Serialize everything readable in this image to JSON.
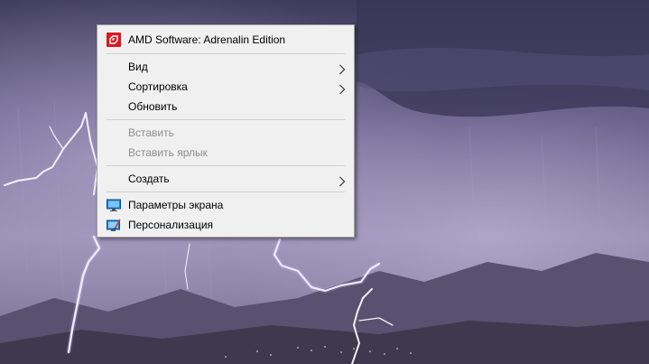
{
  "desktop": {
    "wallpaper": "purple sky with lightning over mountains",
    "colors": {
      "sky_top": "#4e4a6c",
      "sky_mid": "#7d7399",
      "sky_low": "#9a8fb2",
      "ground": "#4a4458"
    }
  },
  "context_menu": {
    "items": [
      {
        "label": "AMD Software: Adrenalin Edition",
        "icon": "amd-radeon-icon",
        "disabled": false,
        "submenu": false
      },
      {
        "type": "separator"
      },
      {
        "label": "Вид",
        "disabled": false,
        "submenu": true
      },
      {
        "label": "Сортировка",
        "disabled": false,
        "submenu": true
      },
      {
        "label": "Обновить",
        "disabled": false,
        "submenu": false
      },
      {
        "type": "separator"
      },
      {
        "label": "Вставить",
        "disabled": true,
        "submenu": false
      },
      {
        "label": "Вставить ярлык",
        "disabled": true,
        "submenu": false
      },
      {
        "type": "separator"
      },
      {
        "label": "Создать",
        "disabled": false,
        "submenu": true
      },
      {
        "type": "separator"
      },
      {
        "label": "Параметры экрана",
        "icon": "display-settings-icon",
        "disabled": false,
        "submenu": false
      },
      {
        "label": "Персонализация",
        "icon": "personalization-icon",
        "disabled": false,
        "submenu": false
      }
    ],
    "colors": {
      "background": "#f0f0f0",
      "border": "#a0a0a0",
      "disabled_text": "#8d8d8d",
      "amd_red": "#d71920"
    }
  }
}
